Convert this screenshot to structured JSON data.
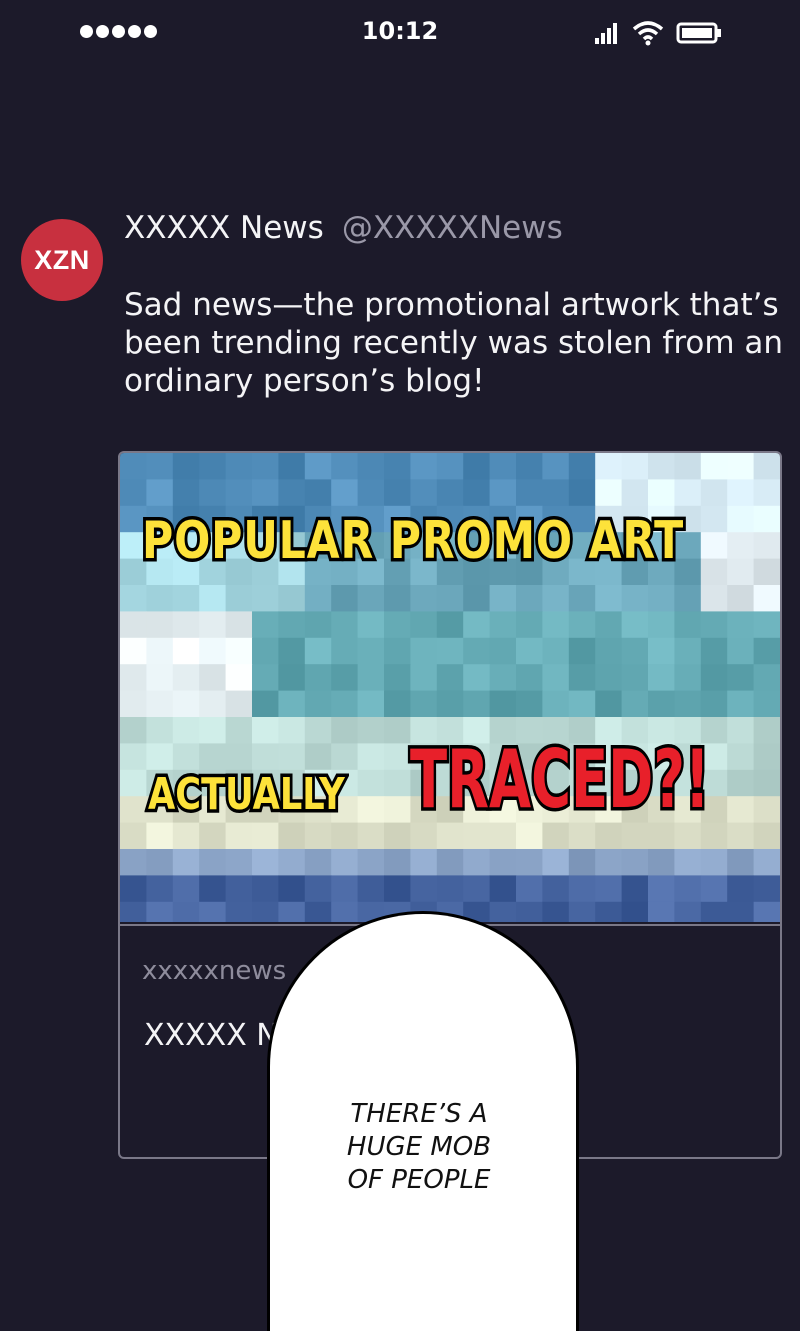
{
  "status_bar": {
    "time": "10:12",
    "icons": [
      "signal-dots-icon",
      "cellular-bars-icon",
      "wifi-icon",
      "battery-icon"
    ]
  },
  "tweet": {
    "avatar_text": "XZN",
    "avatar_color": "#c8303f",
    "name": "XXXXX News",
    "handle": "@XXXXXNews",
    "text": "Sad news—the promotional artwork that’s been trending recently was stolen from an ordinary person’s blog!"
  },
  "card": {
    "headline_line1": "POPULAR PROMO ART",
    "headline_line2_small": "ACTUALLY",
    "headline_line2_big": "TRACED?!",
    "domain": "xxxxxnews",
    "title": "XXXXX N"
  },
  "speech_bubble": {
    "lines": [
      "THERE’S A",
      "HUGE MOB",
      "OF PEOPLE"
    ]
  },
  "colors": {
    "background": "#1c1a2a",
    "headline_yellow": "#fde23a",
    "headline_red": "#e8202a"
  }
}
